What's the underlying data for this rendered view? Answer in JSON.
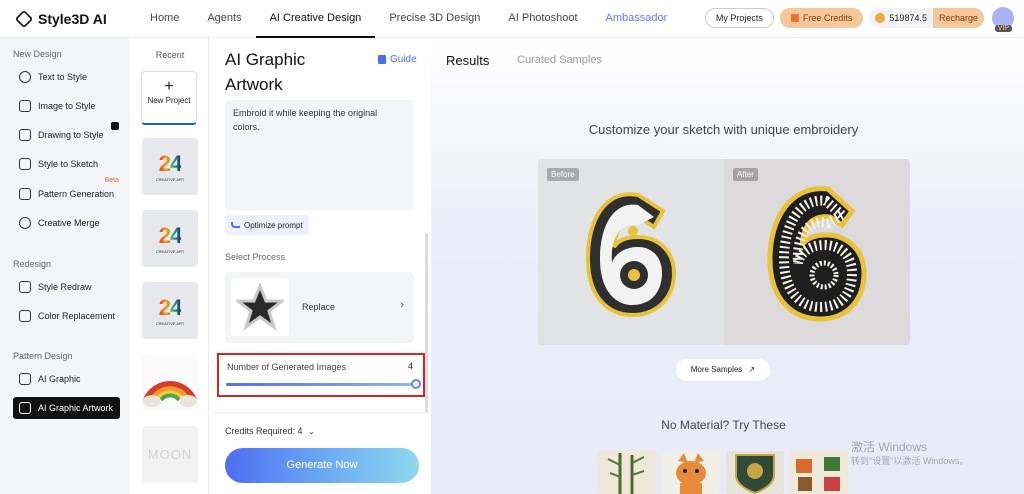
{
  "header": {
    "logo_text": "Style3D AI",
    "nav": [
      "Home",
      "Agents",
      "AI Creative Design",
      "Precise 3D Design",
      "AI Photoshoot",
      "Ambassador"
    ],
    "active_nav": "AI Creative Design",
    "my_projects": "My Projects",
    "free_credits": "Free Credits",
    "credits": "519874.5",
    "recharge": "Recharge",
    "vip": "VIP"
  },
  "sidebar": {
    "sections": [
      {
        "title": "New Design",
        "items": [
          "Text to Style",
          "Image to Style",
          "Drawing to Style",
          "Style to Sketch",
          "Pattern Generation",
          "Creative Merge"
        ]
      },
      {
        "title": "Redesign",
        "items": [
          "Style Redraw",
          "Color Replacement"
        ]
      },
      {
        "title": "Pattern Design",
        "items": [
          "AI Graphic",
          "AI Graphic Artwork"
        ]
      }
    ],
    "beta_badge": "Beta",
    "active_item": "AI Graphic Artwork"
  },
  "recent": {
    "title": "Recent",
    "new_project": "New Project",
    "plus": "+",
    "thumbs": [
      {
        "type": "24",
        "num": "24",
        "sub": "CREATIVE ART"
      },
      {
        "type": "24",
        "num": "24",
        "sub": "CREATIVE ART"
      },
      {
        "type": "24",
        "num": "24",
        "sub": "CREATIVE ART"
      },
      {
        "type": "rainbow"
      },
      {
        "type": "moon",
        "text": "MOON"
      }
    ]
  },
  "panel": {
    "title": "AI Graphic Artwork",
    "guide": "Guide",
    "prompt_text": "Embroid it while keeping the original colors.",
    "optimize": "Optimize prompt",
    "process_label": "Select Process",
    "process_name": "Replace",
    "arrow": "›",
    "num_label": "Number of Generated Images",
    "num_value": "4",
    "num_fraction": 1.0,
    "credits_required": "Credits Required: 4",
    "generate": "Generate Now"
  },
  "results": {
    "tab_results": "Results",
    "tab_curated": "Curated Samples",
    "headline": "Customize your sketch with unique embroidery",
    "before": "Before",
    "after": "After",
    "more_samples": "More Samples",
    "no_material": "No Material? Try These"
  },
  "watermark": {
    "line1": "激活 Windows",
    "line2": "转到\"设置\"以激活 Windows。"
  },
  "colors": {
    "accent": "#4a6cf7",
    "active_bg": "#111111",
    "highlight_border": "#d32525",
    "free_credits_bg": "#f6c79b"
  }
}
